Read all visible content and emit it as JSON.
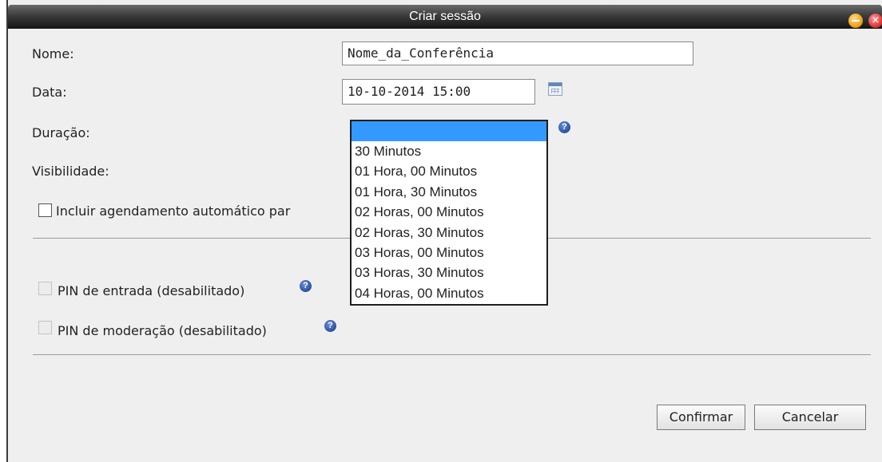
{
  "dialog": {
    "title": "Criar sessão",
    "close_glyph": "×"
  },
  "form": {
    "name_label": "Nome:",
    "name_value": "Nome_da_Conferência",
    "date_label": "Data:",
    "date_value": "10-10-2014 15:00",
    "duration_label": "Duração:",
    "visibility_label": "Visibilidade:",
    "auto_schedule_label": "Incluir agendamento automático par",
    "entry_pin_label": "PIN de entrada (desabilitado)",
    "moderation_pin_label": "PIN de moderação (desabilitado)",
    "help_glyph": "?"
  },
  "duration_options": [
    "",
    "30 Minutos",
    "01 Hora, 00 Minutos",
    "01 Hora, 30 Minutos",
    "02 Horas, 00 Minutos",
    "02 Horas, 30 Minutos",
    "03 Horas, 00 Minutos",
    "03 Horas, 30 Minutos",
    "04 Horas, 00 Minutos"
  ],
  "buttons": {
    "confirm": "Confirmar",
    "cancel": "Cancelar"
  },
  "colors": {
    "title_bar": "#141414",
    "selected_option": "#3399ff",
    "dialog_background": "#efefef"
  },
  "icons": {
    "calendar": "calendar-icon",
    "help": "help-icon",
    "minimize": "minimize-icon",
    "close": "close-icon"
  }
}
